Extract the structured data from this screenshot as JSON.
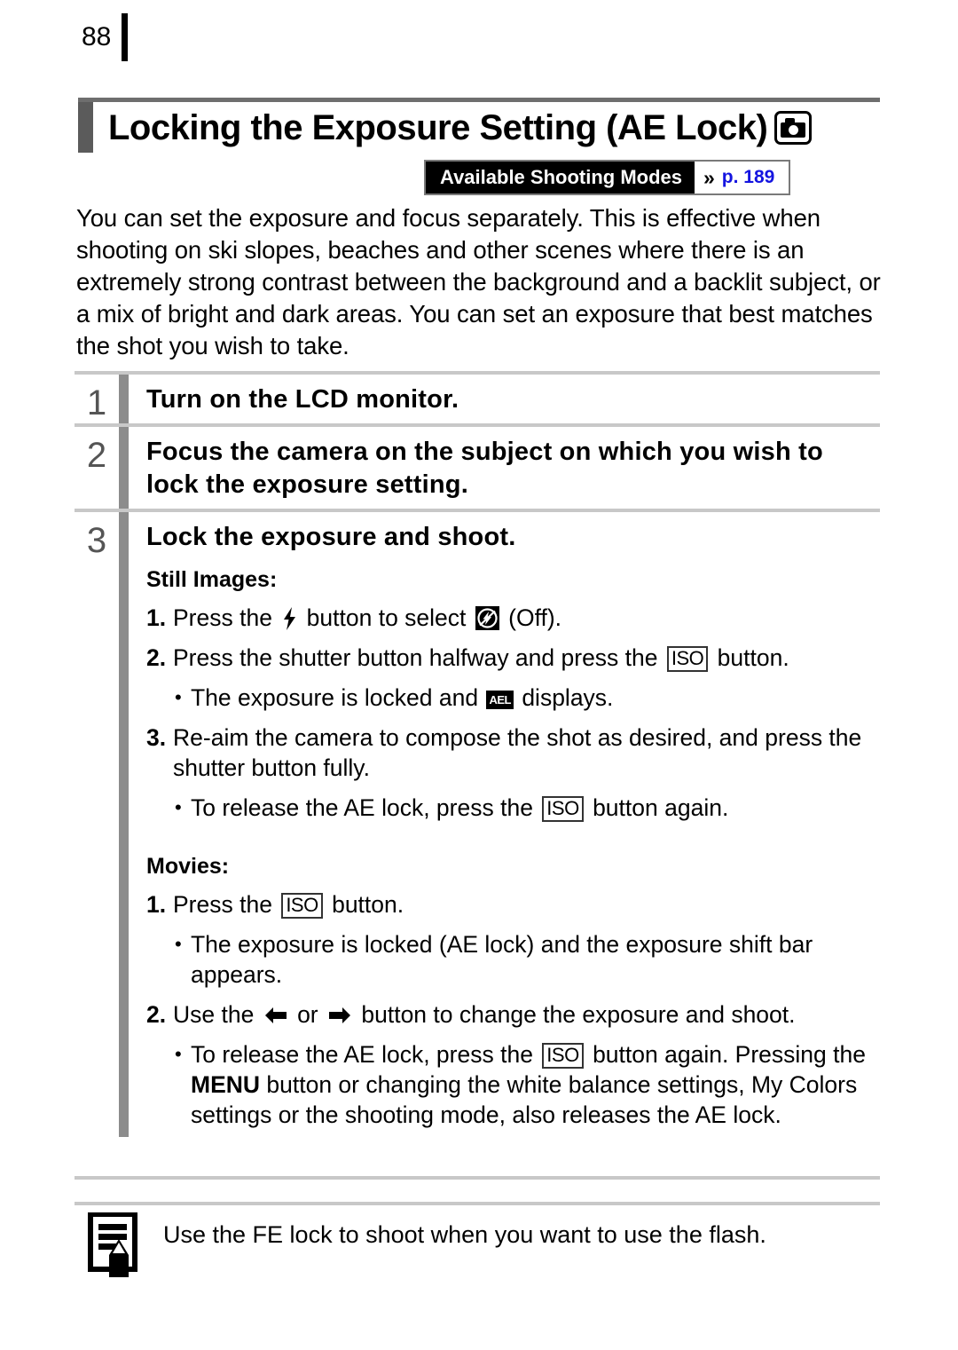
{
  "page": {
    "number": "88"
  },
  "title": {
    "text": "Locking the Exposure Setting (AE Lock)",
    "icon": "camera-icon"
  },
  "modes_badge": {
    "label": "Available Shooting Modes",
    "chevron": "»",
    "page_link": "p. 189",
    "link_color": "#1414e0"
  },
  "intro": "You can set the exposure and focus separately. This is effective when shooting on ski slopes, beaches and other scenes where there is an extremely strong contrast between the background and a backlit subject, or a mix of bright and dark areas. You can set an exposure that best matches the shot you wish to take.",
  "steps": [
    {
      "number": "1",
      "title": "Turn on the LCD monitor."
    },
    {
      "number": "2",
      "title": "Focus the camera on the subject on which you wish to lock the exposure setting."
    },
    {
      "number": "3",
      "title": "Lock the exposure and shoot.",
      "sections": [
        {
          "heading": "Still Images:",
          "items": [
            {
              "marker": "1.",
              "pre": "Press the ",
              "icon1": "flash-icon",
              "mid": " button to select ",
              "icon2": "flash-off-icon",
              "post": " (Off)."
            },
            {
              "marker": "2.",
              "pre": "Press the shutter button halfway and press the ",
              "icon1": "iso-button-icon",
              "post": " button."
            },
            {
              "marker": "•",
              "pre": "The exposure is locked and ",
              "icon1": "ael-indicator-icon",
              "post": " displays."
            },
            {
              "marker": "3.",
              "pre": "Re-aim the camera to compose the shot as desired, and press the shutter button fully."
            },
            {
              "marker": "•",
              "pre": "To release the AE lock, press the ",
              "icon1": "iso-button-icon",
              "post": " button again."
            }
          ]
        },
        {
          "heading": "Movies:",
          "items": [
            {
              "marker": "1.",
              "pre": "Press the ",
              "icon1": "iso-button-icon",
              "post": " button."
            },
            {
              "marker": "•",
              "pre": "The exposure is locked (AE lock) and the exposure shift bar appears."
            },
            {
              "marker": "2.",
              "pre": "Use the ",
              "icon1": "arrow-left-icon",
              "mid": " or ",
              "icon2": "arrow-right-icon",
              "post": " button to change the exposure and shoot."
            },
            {
              "marker": "•",
              "pre": "To release the AE lock, press the ",
              "icon1": "iso-button-icon",
              "mid": " button again. Pressing the ",
              "bold": "MENU",
              "post": " button or changing the white balance settings, My Colors settings or the shooting mode, also releases the AE lock."
            }
          ]
        }
      ]
    }
  ],
  "note": {
    "icon": "memo-note-icon",
    "text": "Use the FE lock to shoot when you want to use the flash."
  }
}
